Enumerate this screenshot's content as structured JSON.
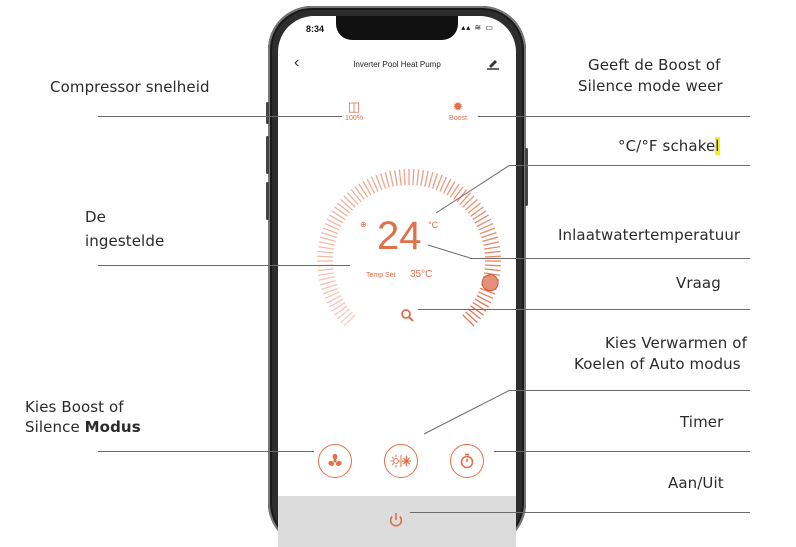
{
  "status_bar": {
    "time": "8:34",
    "icons": "▴▴ ≋ ▭"
  },
  "header": {
    "title": "Inverter Pool Heat Pump",
    "back_icon": "chevron-left-icon",
    "edit_icon": "pencil-icon"
  },
  "compressor": {
    "value": "100%",
    "icon": "compressor-icon"
  },
  "mode": {
    "value": "Boost",
    "icon": "sun-icon"
  },
  "temperature": {
    "current": "24",
    "unit": "°C",
    "mark": "⊕",
    "set_label": "Temp Set",
    "set_value": "35°C"
  },
  "buttons": {
    "search_icon": "search-icon",
    "fan_icon": "fan-icon",
    "mode_icon": "heat-cool-icon",
    "timer_icon": "timer-icon",
    "power_icon": "power-icon"
  },
  "callouts": {
    "compressor_speed": "Compressor snelheid",
    "boost_display_1": "Geeft de Boost of",
    "boost_display_2": "Silence mode weer",
    "unit_switch_prefix": "°C/°F ",
    "unit_switch_bold": "schake",
    "unit_switch_highlight": "l",
    "set_temp_1": "De",
    "set_temp_2": "ingestelde",
    "inlet_temp": "Inlaatwatertemperatuur",
    "query": "Vraag",
    "heat_cool_1": "Kies Verwarmen of",
    "heat_cool_2": "Koelen of Auto modus",
    "boost_silence_1": "Kies Boost of",
    "boost_silence_2_prefix": "Silence ",
    "boost_silence_2_bold": "Modus",
    "timer": "Timer",
    "on_off": "Aan/Uit"
  },
  "colors": {
    "accent": "#e0704a",
    "bar": "#dcdcdc"
  }
}
